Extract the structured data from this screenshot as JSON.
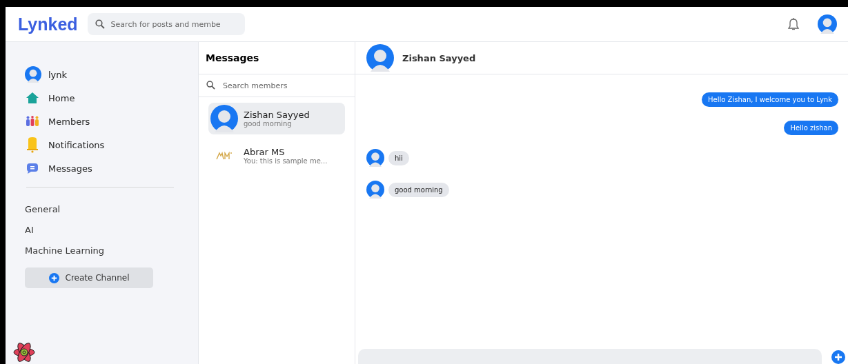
{
  "header": {
    "logo": "Lynked",
    "search": {
      "placeholder": "Search for posts and membe"
    }
  },
  "sidebar": {
    "user": "lynk",
    "nav": [
      {
        "label": "Home",
        "kind": "home"
      },
      {
        "label": "Members",
        "kind": "members"
      },
      {
        "label": "Notifications",
        "kind": "bell"
      },
      {
        "label": "Messages",
        "kind": "chat"
      }
    ],
    "channels": [
      "General",
      "AI",
      "Machine Learning"
    ],
    "create_button": "Create Channel"
  },
  "conversations": {
    "title": "Messages",
    "search": {
      "placeholder": "Search members"
    },
    "items": [
      {
        "name": "Zishan Sayyed",
        "preview": "good morning",
        "kind": "person",
        "selected": true
      },
      {
        "name": "Abrar MS",
        "preview": "You: this is sample me...",
        "kind": "logo",
        "selected": false
      }
    ]
  },
  "chat": {
    "contact": "Zishan Sayyed",
    "messages": [
      {
        "text": "Hello Zishan, I welcome you to Lynk",
        "kind": "outgoing"
      },
      {
        "text": "Hello zishan",
        "kind": "outgoing"
      },
      {
        "text": "hii",
        "kind": "incoming"
      },
      {
        "text": "good morning",
        "kind": "incoming"
      }
    ]
  }
}
